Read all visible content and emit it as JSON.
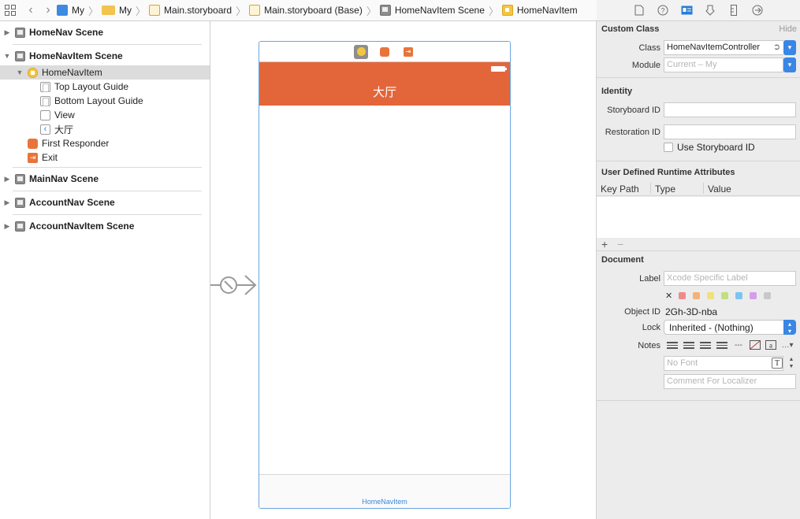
{
  "jumpbar": {
    "crumbs": [
      "My",
      "My",
      "Main.storyboard",
      "Main.storyboard (Base)",
      "HomeNavItem Scene",
      "HomeNavItem"
    ]
  },
  "outline": {
    "scenes": [
      {
        "label": "HomeNav Scene"
      },
      {
        "label": "HomeNavItem Scene"
      },
      {
        "label": "MainNav Scene"
      },
      {
        "label": "AccountNav Scene"
      },
      {
        "label": "AccountNavItem Scene"
      }
    ],
    "controller": "HomeNavItem",
    "children": [
      "Top Layout Guide",
      "Bottom Layout Guide",
      "View",
      "大厅"
    ],
    "first_responder": "First Responder",
    "exit": "Exit"
  },
  "canvas": {
    "nav_title": "大厅",
    "tab_label": "HomeNavItem"
  },
  "inspector": {
    "custom_class": {
      "title": "Custom Class",
      "hide": "Hide",
      "class_label": "Class",
      "class_value": "HomeNavItemController",
      "module_label": "Module",
      "module_placeholder": "Current – My"
    },
    "identity": {
      "title": "Identity",
      "storyboard_id_label": "Storyboard ID",
      "storyboard_id_value": "",
      "restoration_id_label": "Restoration ID",
      "restoration_id_value": "",
      "use_storyboard_id": "Use Storyboard ID"
    },
    "runtime_attrs": {
      "title": "User Defined Runtime Attributes",
      "columns": [
        "Key Path",
        "Type",
        "Value"
      ],
      "add": "+",
      "remove": "−"
    },
    "document": {
      "title": "Document",
      "label_label": "Label",
      "label_placeholder": "Xcode Specific Label",
      "clear": "✕",
      "swatch_colors": [
        "#f08a8a",
        "#f3b27a",
        "#f2e07a",
        "#c2e07c",
        "#7cc4f0",
        "#d59ee8",
        "#c8c8c8"
      ],
      "object_id_label": "Object ID",
      "object_id_value": "2Gh-3D-nba",
      "lock_label": "Lock",
      "lock_value": "Inherited - (Nothing)",
      "notes_label": "Notes",
      "font_placeholder": "No Font",
      "comment_placeholder": "Comment For Localizer"
    }
  },
  "colors": {
    "navbar": "#e3663b",
    "accent": "#3a86e4"
  }
}
